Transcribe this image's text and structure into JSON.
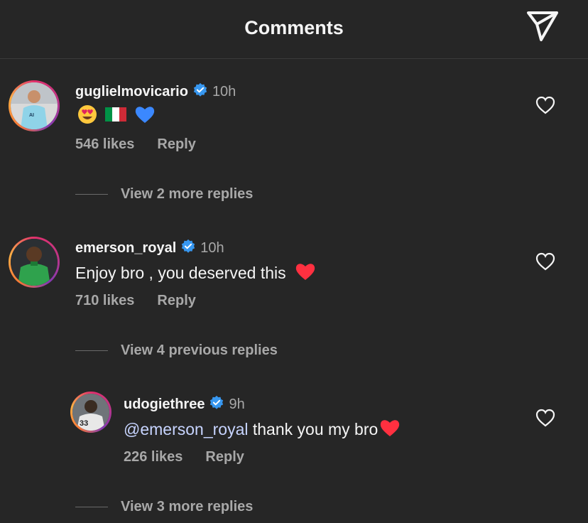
{
  "header": {
    "title": "Comments",
    "send_icon": "paper-plane-icon"
  },
  "colors": {
    "background": "#262626",
    "text": "#f5f5f5",
    "muted": "#a8a8a8",
    "verified": "#3797f0",
    "heart_red": "#ff3040"
  },
  "comments": [
    {
      "username": "guglielmovicario",
      "verified": true,
      "time": "10h",
      "text": "😍🇮🇹💙",
      "likes": "546 likes",
      "reply": "Reply",
      "view_more": "View 2 more replies"
    },
    {
      "username": "emerson_royal",
      "verified": true,
      "time": "10h",
      "text": "Enjoy bro , you deserved this",
      "likes": "710 likes",
      "reply": "Reply",
      "view_more": "View 4 previous replies"
    },
    {
      "username": "udogiethree",
      "verified": true,
      "time": "9h",
      "mention": "@emerson_royal",
      "text": " thank you my bro",
      "likes": "226 likes",
      "reply": "Reply",
      "view_more": "View 3 more replies"
    }
  ]
}
